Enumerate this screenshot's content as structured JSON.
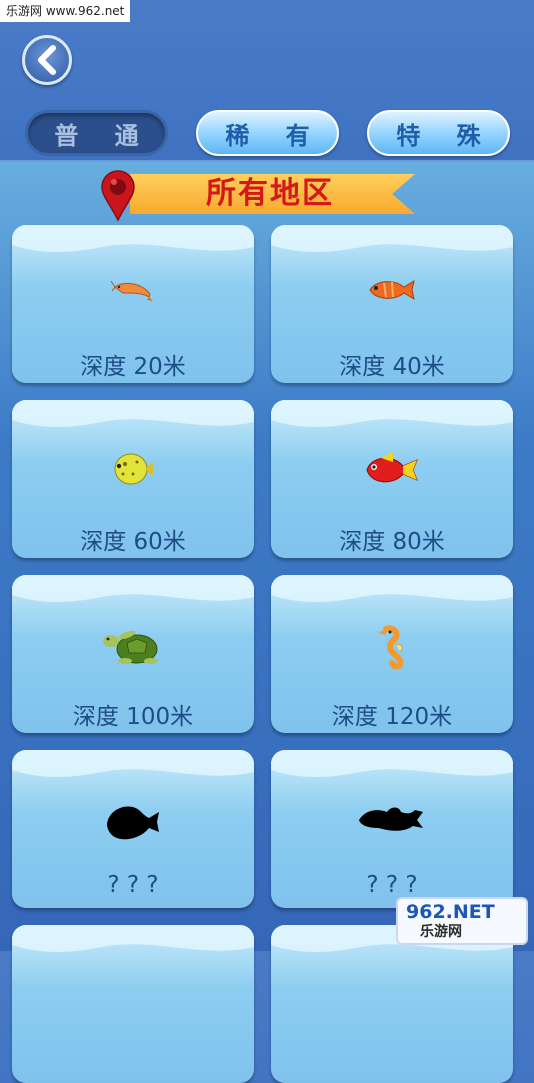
{
  "watermark": "乐游网 www.962.net",
  "tabs": [
    {
      "label": "普 通",
      "active": true
    },
    {
      "label": "稀 有",
      "active": false
    },
    {
      "label": "特 殊",
      "active": false
    }
  ],
  "banner": {
    "title": "所有地区"
  },
  "cards": [
    {
      "label": "深度 20米",
      "icon": "shrimp-icon"
    },
    {
      "label": "深度 40米",
      "icon": "orange-fish-icon"
    },
    {
      "label": "深度 60米",
      "icon": "pufferfish-icon"
    },
    {
      "label": "深度 80米",
      "icon": "red-fish-icon"
    },
    {
      "label": "深度 100米",
      "icon": "sea-turtle-icon"
    },
    {
      "label": "深度 120米",
      "icon": "seahorse-icon"
    },
    {
      "label": "? ? ?",
      "icon": "locked-fish-silhouette-icon"
    },
    {
      "label": "? ? ?",
      "icon": "locked-fish-silhouette-icon"
    }
  ],
  "corner_logo": {
    "brand": "962.NET",
    "sub": "乐游网"
  },
  "colors": {
    "background": "#3f73c2",
    "tab_active": "#2b4f8c",
    "banner": "#f7a92f",
    "banner_text": "#d41818",
    "label_text": "#1e4c86"
  }
}
